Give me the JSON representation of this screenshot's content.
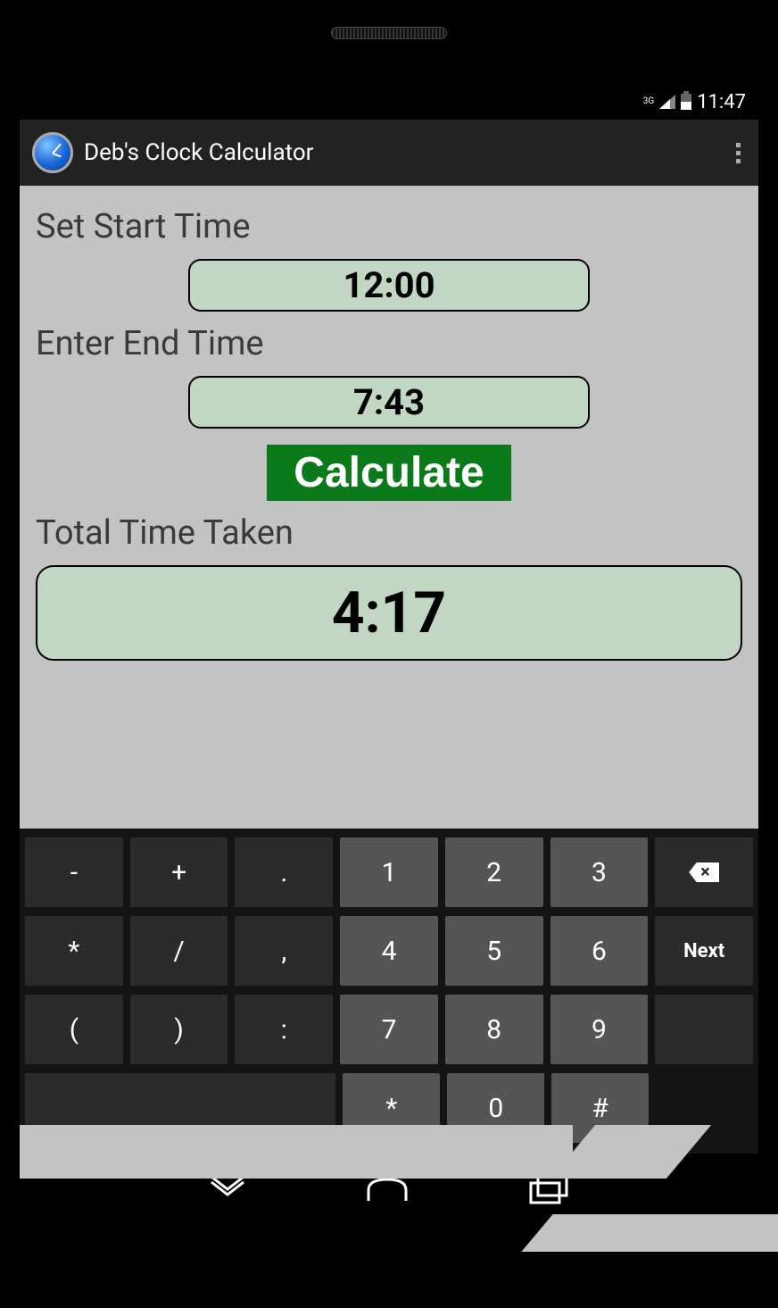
{
  "status": {
    "network_label": "3G",
    "clock": "11:47"
  },
  "titlebar": {
    "app_title": "Deb's Clock Calculator"
  },
  "form": {
    "start_label": "Set Start Time",
    "start_value": "12:00",
    "end_label": "Enter End Time",
    "end_value": "7:43",
    "calculate_label": "Calculate",
    "total_label": "Total Time Taken",
    "total_value": "4:17"
  },
  "keyboard": {
    "rows": [
      [
        "-",
        "+",
        ".",
        "1",
        "2",
        "3",
        "⌫"
      ],
      [
        "*",
        "/",
        ",",
        "4",
        "5",
        "6",
        "Next"
      ],
      [
        "(",
        ")",
        ":",
        "7",
        "8",
        "9",
        ""
      ],
      [
        "",
        "*",
        "0",
        "#"
      ]
    ],
    "next_label": "Next"
  }
}
